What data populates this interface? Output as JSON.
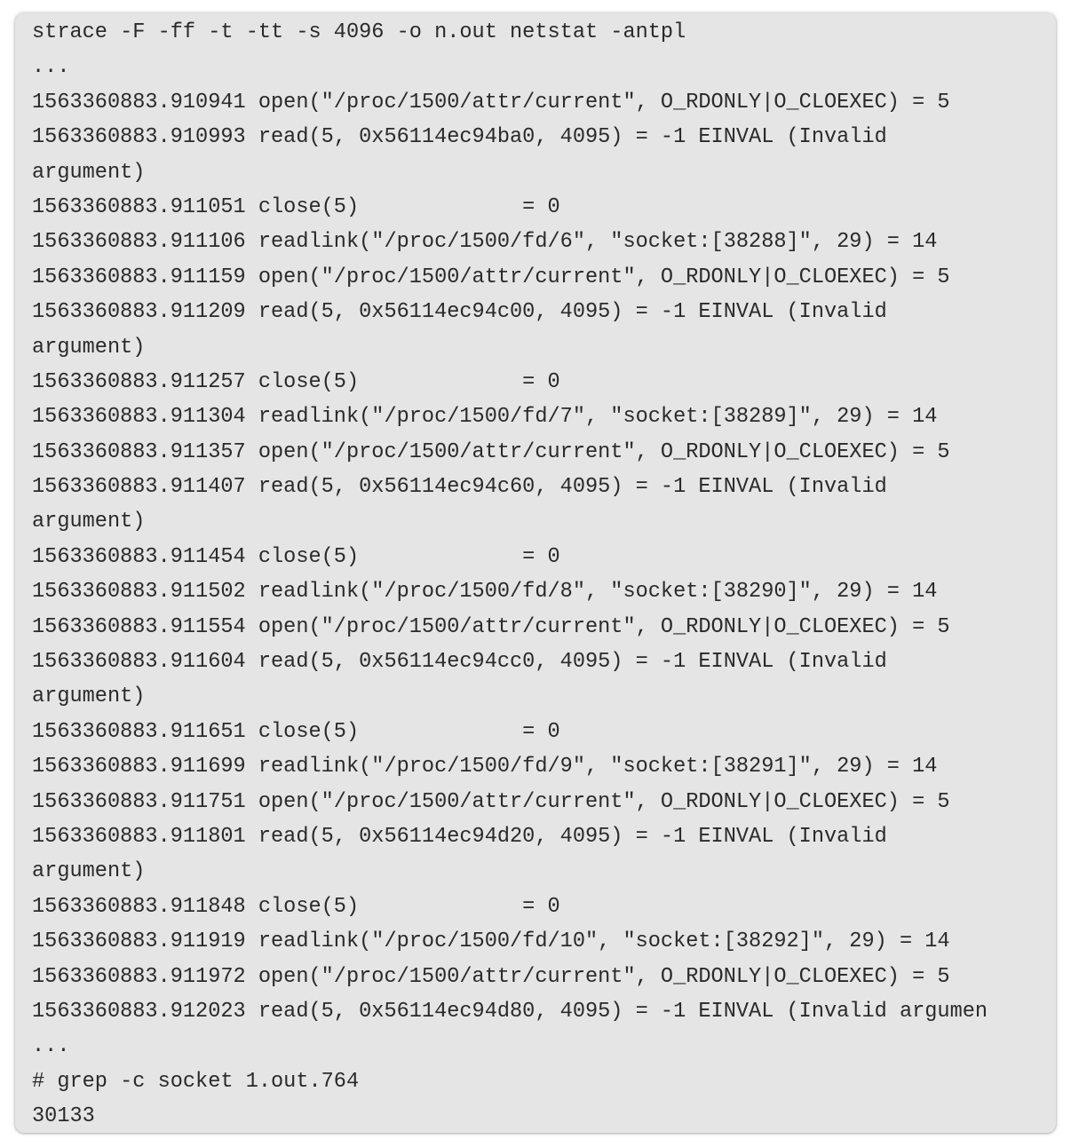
{
  "terminal": {
    "lines": [
      "strace -F -ff -t -tt -s 4096 -o n.out netstat -antpl",
      "...",
      "1563360883.910941 open(\"/proc/1500/attr/current\", O_RDONLY|O_CLOEXEC) = 5",
      "1563360883.910993 read(5, 0x56114ec94ba0, 4095) = -1 EINVAL (Invalid",
      "argument)",
      "1563360883.911051 close(5)             = 0",
      "1563360883.911106 readlink(\"/proc/1500/fd/6\", \"socket:[38288]\", 29) = 14",
      "1563360883.911159 open(\"/proc/1500/attr/current\", O_RDONLY|O_CLOEXEC) = 5",
      "1563360883.911209 read(5, 0x56114ec94c00, 4095) = -1 EINVAL (Invalid",
      "argument)",
      "1563360883.911257 close(5)             = 0",
      "1563360883.911304 readlink(\"/proc/1500/fd/7\", \"socket:[38289]\", 29) = 14",
      "1563360883.911357 open(\"/proc/1500/attr/current\", O_RDONLY|O_CLOEXEC) = 5",
      "1563360883.911407 read(5, 0x56114ec94c60, 4095) = -1 EINVAL (Invalid",
      "argument)",
      "1563360883.911454 close(5)             = 0",
      "1563360883.911502 readlink(\"/proc/1500/fd/8\", \"socket:[38290]\", 29) = 14",
      "1563360883.911554 open(\"/proc/1500/attr/current\", O_RDONLY|O_CLOEXEC) = 5",
      "1563360883.911604 read(5, 0x56114ec94cc0, 4095) = -1 EINVAL (Invalid",
      "argument)",
      "1563360883.911651 close(5)             = 0",
      "1563360883.911699 readlink(\"/proc/1500/fd/9\", \"socket:[38291]\", 29) = 14",
      "1563360883.911751 open(\"/proc/1500/attr/current\", O_RDONLY|O_CLOEXEC) = 5",
      "1563360883.911801 read(5, 0x56114ec94d20, 4095) = -1 EINVAL (Invalid",
      "argument)",
      "1563360883.911848 close(5)             = 0",
      "1563360883.911919 readlink(\"/proc/1500/fd/10\", \"socket:[38292]\", 29) = 14",
      "1563360883.911972 open(\"/proc/1500/attr/current\", O_RDONLY|O_CLOEXEC) = 5",
      "1563360883.912023 read(5, 0x56114ec94d80, 4095) = -1 EINVAL (Invalid argumen",
      "...",
      "# grep -c socket 1.out.764",
      "30133"
    ]
  }
}
